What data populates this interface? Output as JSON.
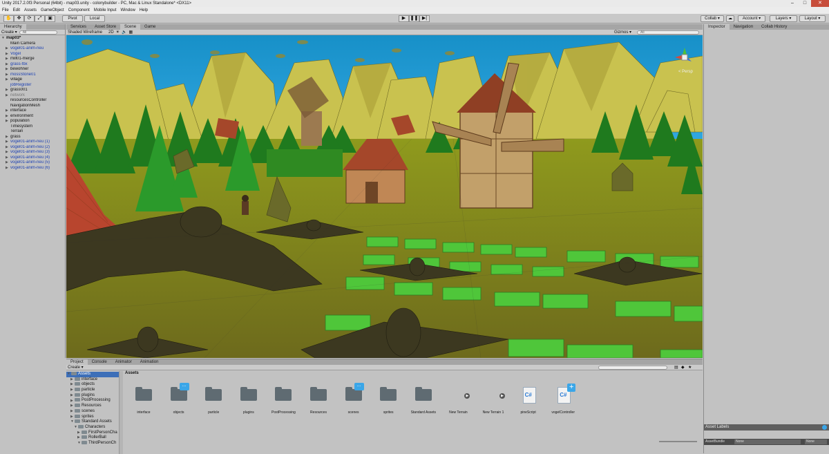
{
  "window": {
    "title": "Unity 2017.2.0f3 Personal (64bit) - map03.unity - colonybuilder - PC, Mac & Linux Standalone* <DX11>",
    "controls": [
      "–",
      "□",
      "✕"
    ]
  },
  "menu": [
    "File",
    "Edit",
    "Assets",
    "GameObject",
    "Component",
    "Mobile Input",
    "Window",
    "Help"
  ],
  "toolbar": {
    "pivot": "Pivot",
    "local": "Local",
    "collab": "Collab ▾",
    "account": "Account ▾",
    "layers": "Layers ▾",
    "layout": "Layout ▾"
  },
  "hierarchy": {
    "tab": "Hierarchy",
    "create": "Create ▾",
    "search_placeholder": "All",
    "rows": [
      {
        "label": "map03*",
        "indent": 0,
        "arrow": "▼",
        "style": "bold"
      },
      {
        "label": "Main Camera",
        "indent": 1,
        "arrow": "",
        "style": "normal"
      },
      {
        "label": "vogel01-anim-neu",
        "indent": 1,
        "arrow": "▶",
        "style": "blue"
      },
      {
        "label": "Vogel",
        "indent": 1,
        "arrow": "▶",
        "style": "blue"
      },
      {
        "label": "mill01-merge",
        "indent": 1,
        "arrow": "▶",
        "style": "normal"
      },
      {
        "label": "grass-fbx",
        "indent": 1,
        "arrow": "▶",
        "style": "blue"
      },
      {
        "label": "bewohner",
        "indent": 1,
        "arrow": "▶",
        "style": "normal"
      },
      {
        "label": "mossStone01",
        "indent": 1,
        "arrow": "▶",
        "style": "blue"
      },
      {
        "label": "village",
        "indent": 1,
        "arrow": "▶",
        "style": "normal"
      },
      {
        "label": "jobRegister",
        "indent": 1,
        "arrow": "",
        "style": "blue"
      },
      {
        "label": "grass001",
        "indent": 1,
        "arrow": "▶",
        "style": "normal"
      },
      {
        "label": "network",
        "indent": 1,
        "arrow": "▶",
        "style": "grey"
      },
      {
        "label": "resourcesController",
        "indent": 1,
        "arrow": "",
        "style": "normal"
      },
      {
        "label": "NavigationMesh",
        "indent": 1,
        "arrow": "",
        "style": "normal"
      },
      {
        "label": "interface",
        "indent": 1,
        "arrow": "▶",
        "style": "normal"
      },
      {
        "label": "environment",
        "indent": 1,
        "arrow": "▶",
        "style": "normal"
      },
      {
        "label": "population",
        "indent": 1,
        "arrow": "▶",
        "style": "normal"
      },
      {
        "label": "Timesystem",
        "indent": 1,
        "arrow": "",
        "style": "normal"
      },
      {
        "label": "Terrain",
        "indent": 1,
        "arrow": "",
        "style": "normal"
      },
      {
        "label": "grass",
        "indent": 1,
        "arrow": "▶",
        "style": "normal"
      },
      {
        "label": "vogel01-anim-neu (1)",
        "indent": 1,
        "arrow": "▶",
        "style": "blue"
      },
      {
        "label": "vogel01-anim-neu (2)",
        "indent": 1,
        "arrow": "▶",
        "style": "blue"
      },
      {
        "label": "vogel01-anim-neu (3)",
        "indent": 1,
        "arrow": "▶",
        "style": "blue"
      },
      {
        "label": "vogel01-anim-neu (4)",
        "indent": 1,
        "arrow": "▶",
        "style": "blue"
      },
      {
        "label": "vogel01-anim-neu (5)",
        "indent": 1,
        "arrow": "▶",
        "style": "blue"
      },
      {
        "label": "vogel01-anim-neu (6)",
        "indent": 1,
        "arrow": "▶",
        "style": "blue"
      }
    ]
  },
  "scene": {
    "tabs": [
      "Services",
      "Asset Store",
      "Scene",
      "Game"
    ],
    "active_tab": "Scene",
    "shading": "Shaded Wireframe",
    "mode_2d": "2D",
    "gizmos": "Gizmos ▾",
    "search_placeholder": "All",
    "persp": "< Persp"
  },
  "inspector": {
    "tabs": [
      "Inspector",
      "Navigation",
      "Collab History"
    ],
    "asset_labels": "Asset Labels",
    "asset_bundle": "AssetBundle",
    "bundle_value": "None",
    "variant_value": "None"
  },
  "project": {
    "tabs": [
      "Project",
      "Console",
      "Animator",
      "Animation"
    ],
    "create": "Create ▾",
    "assets_header": "Assets",
    "folders": [
      {
        "label": "Assets",
        "indent": 0,
        "arrow": "▼",
        "selected": true
      },
      {
        "label": "interface",
        "indent": 1,
        "arrow": "▶"
      },
      {
        "label": "objects",
        "indent": 1,
        "arrow": "▶"
      },
      {
        "label": "particle",
        "indent": 1,
        "arrow": "▶"
      },
      {
        "label": "plugins",
        "indent": 1,
        "arrow": "▶"
      },
      {
        "label": "PostProcessing",
        "indent": 1,
        "arrow": "▶"
      },
      {
        "label": "Resources",
        "indent": 1,
        "arrow": "▶"
      },
      {
        "label": "scenes",
        "indent": 1,
        "arrow": "▶"
      },
      {
        "label": "sprites",
        "indent": 1,
        "arrow": "▶"
      },
      {
        "label": "Standard Assets",
        "indent": 1,
        "arrow": "▼"
      },
      {
        "label": "Characters",
        "indent": 2,
        "arrow": "▼"
      },
      {
        "label": "FirstPersonCha",
        "indent": 3,
        "arrow": "▶"
      },
      {
        "label": "RollerBall",
        "indent": 3,
        "arrow": "▶"
      },
      {
        "label": "ThirdPersonCh",
        "indent": 3,
        "arrow": "▼"
      }
    ],
    "assets": [
      {
        "label": "interface",
        "type": "folder"
      },
      {
        "label": "objects",
        "type": "folder",
        "badge": "..."
      },
      {
        "label": "particle",
        "type": "folder"
      },
      {
        "label": "plugins",
        "type": "folder"
      },
      {
        "label": "PostProcessing",
        "type": "folder"
      },
      {
        "label": "Resources",
        "type": "folder"
      },
      {
        "label": "scenes",
        "type": "folder",
        "badge": "..."
      },
      {
        "label": "sprites",
        "type": "folder"
      },
      {
        "label": "Standard Assets",
        "type": "folder"
      },
      {
        "label": "New Terrain",
        "type": "terrain"
      },
      {
        "label": "New Terrain 1",
        "type": "terrain"
      },
      {
        "label": "pineScript",
        "type": "script"
      },
      {
        "label": "vogelController",
        "type": "script",
        "badge": "+"
      }
    ]
  }
}
